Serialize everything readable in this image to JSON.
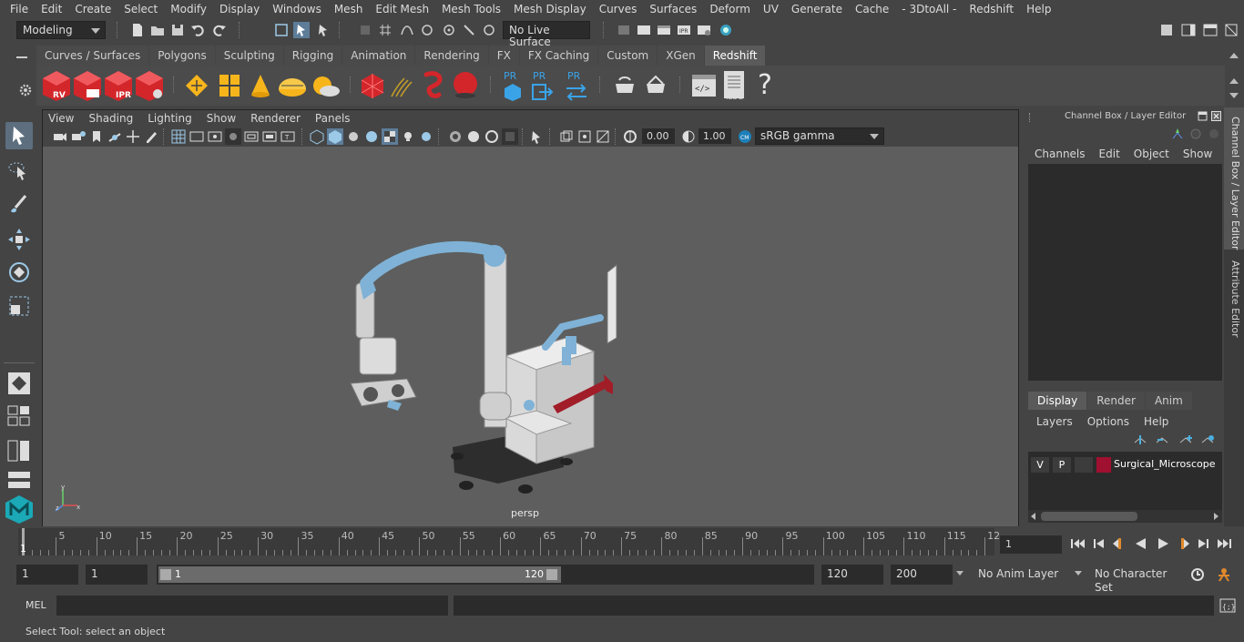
{
  "menubar": [
    "File",
    "Edit",
    "Create",
    "Select",
    "Modify",
    "Display",
    "Windows",
    "Mesh",
    "Edit Mesh",
    "Mesh Tools",
    "Mesh Display",
    "Curves",
    "Surfaces",
    "Deform",
    "UV",
    "Generate",
    "Cache",
    "- 3DtoAll -",
    "Redshift",
    "Help"
  ],
  "statusline": {
    "mode": "Modeling",
    "live_surface": "No Live Surface"
  },
  "shelf": {
    "tabs": [
      "Curves / Surfaces",
      "Polygons",
      "Sculpting",
      "Rigging",
      "Animation",
      "Rendering",
      "FX",
      "FX Caching",
      "Custom",
      "XGen",
      "Redshift"
    ],
    "active_tab": "Redshift",
    "icon_labels": {
      "rv": "RV",
      "ipr": "IPR",
      "pr1": "PR",
      "pr2": "PR",
      "pr3": "PR",
      "log": ".LOG",
      "help": "?"
    }
  },
  "viewport": {
    "menu": [
      "View",
      "Shading",
      "Lighting",
      "Show",
      "Renderer",
      "Panels"
    ],
    "exposure": "0.00",
    "gamma": "1.00",
    "colorspace": "sRGB gamma",
    "camera_label": "persp"
  },
  "channelbox": {
    "title": "Channel Box / Layer Editor",
    "menu": [
      "Channels",
      "Edit",
      "Object",
      "Show"
    ],
    "layer_tabs": [
      "Display",
      "Render",
      "Anim"
    ],
    "active_layer_tab": "Display",
    "layer_menu": [
      "Layers",
      "Options",
      "Help"
    ],
    "layers": [
      {
        "v": "V",
        "p": "P",
        "color": "#a01030",
        "name": "Surgical_Microscope"
      }
    ]
  },
  "side_tabs": [
    "Channel Box / Layer Editor",
    "Attribute Editor"
  ],
  "timeline": {
    "ticks": [
      "5",
      "10",
      "15",
      "20",
      "25",
      "30",
      "35",
      "40",
      "45",
      "50",
      "55",
      "60",
      "65",
      "70",
      "75",
      "80",
      "85",
      "90",
      "95",
      "100",
      "105",
      "110",
      "115",
      "12"
    ],
    "start_marker": "1",
    "current_frame": "1"
  },
  "range": {
    "start": "1",
    "start2": "1",
    "slider_start": "1",
    "slider_end": "120",
    "end": "120",
    "end2": "200",
    "anim_layer": "No Anim Layer",
    "character_set": "No Character Set"
  },
  "cmdline": {
    "label": "MEL"
  },
  "helpline": "Select Tool: select an object"
}
